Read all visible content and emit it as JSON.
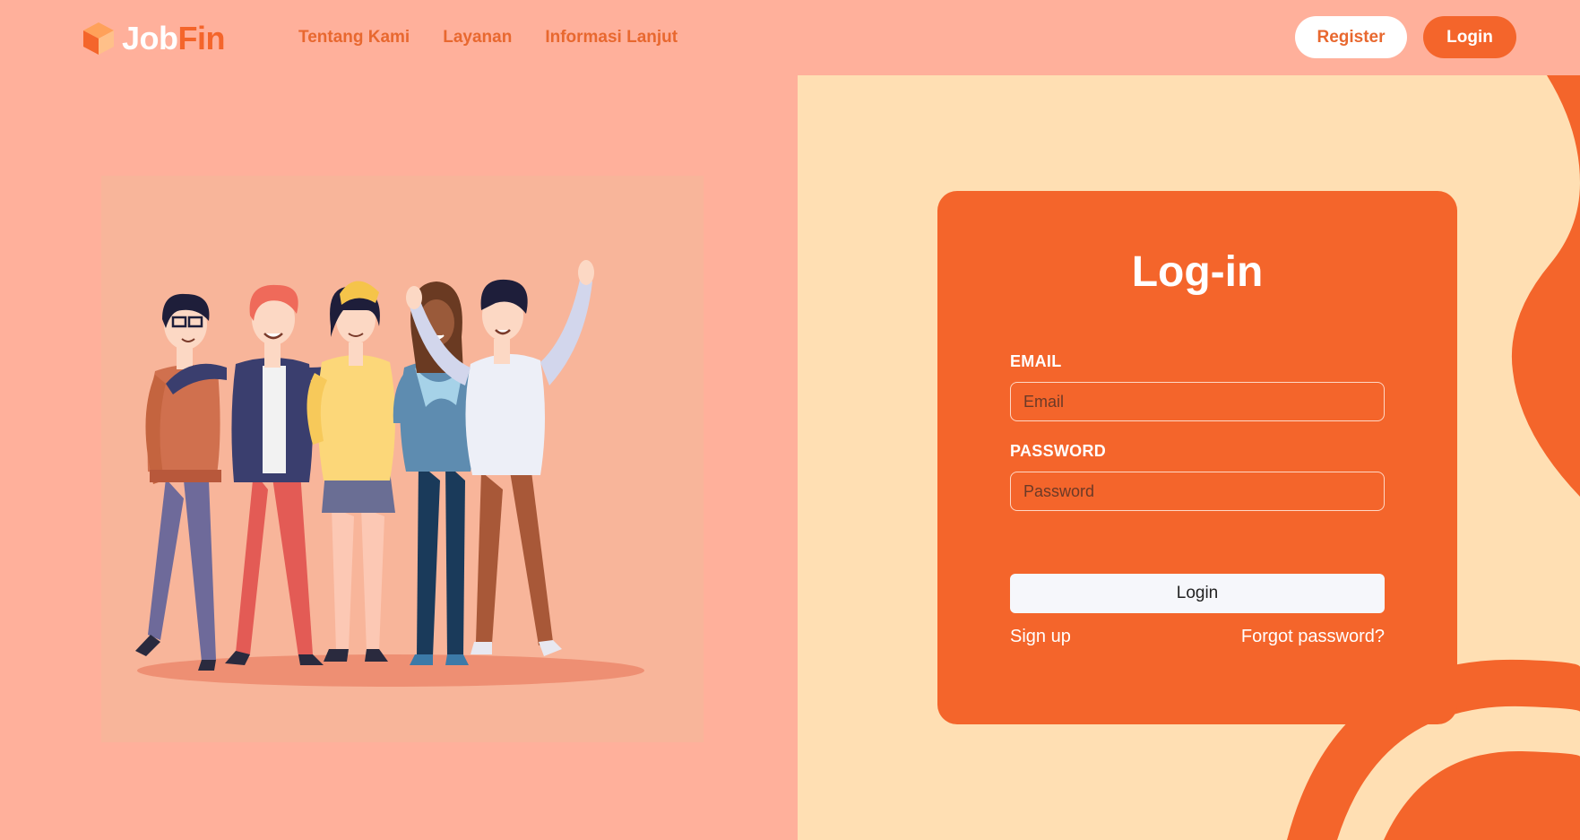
{
  "nav": {
    "logo": {
      "job": "Job",
      "fin": "Fin"
    },
    "links": [
      "Tentang Kami",
      "Layanan",
      "Informasi Lanjut"
    ],
    "register_label": "Register",
    "login_label": "Login"
  },
  "login_form": {
    "title": "Log-in",
    "email_label": "EMAIL",
    "email_placeholder": "Email",
    "password_label": "PASSWORD",
    "password_placeholder": "Password",
    "submit_label": "Login",
    "signup_label": "Sign up",
    "forgot_label": "Forgot password?"
  },
  "colors": {
    "background": "#FFB09B",
    "accent": "#F4652B",
    "right_panel": "#FFDFB3",
    "illustration_bg": "#F8B59A"
  },
  "icons": {
    "logo": "orange-cube-logo-icon"
  }
}
